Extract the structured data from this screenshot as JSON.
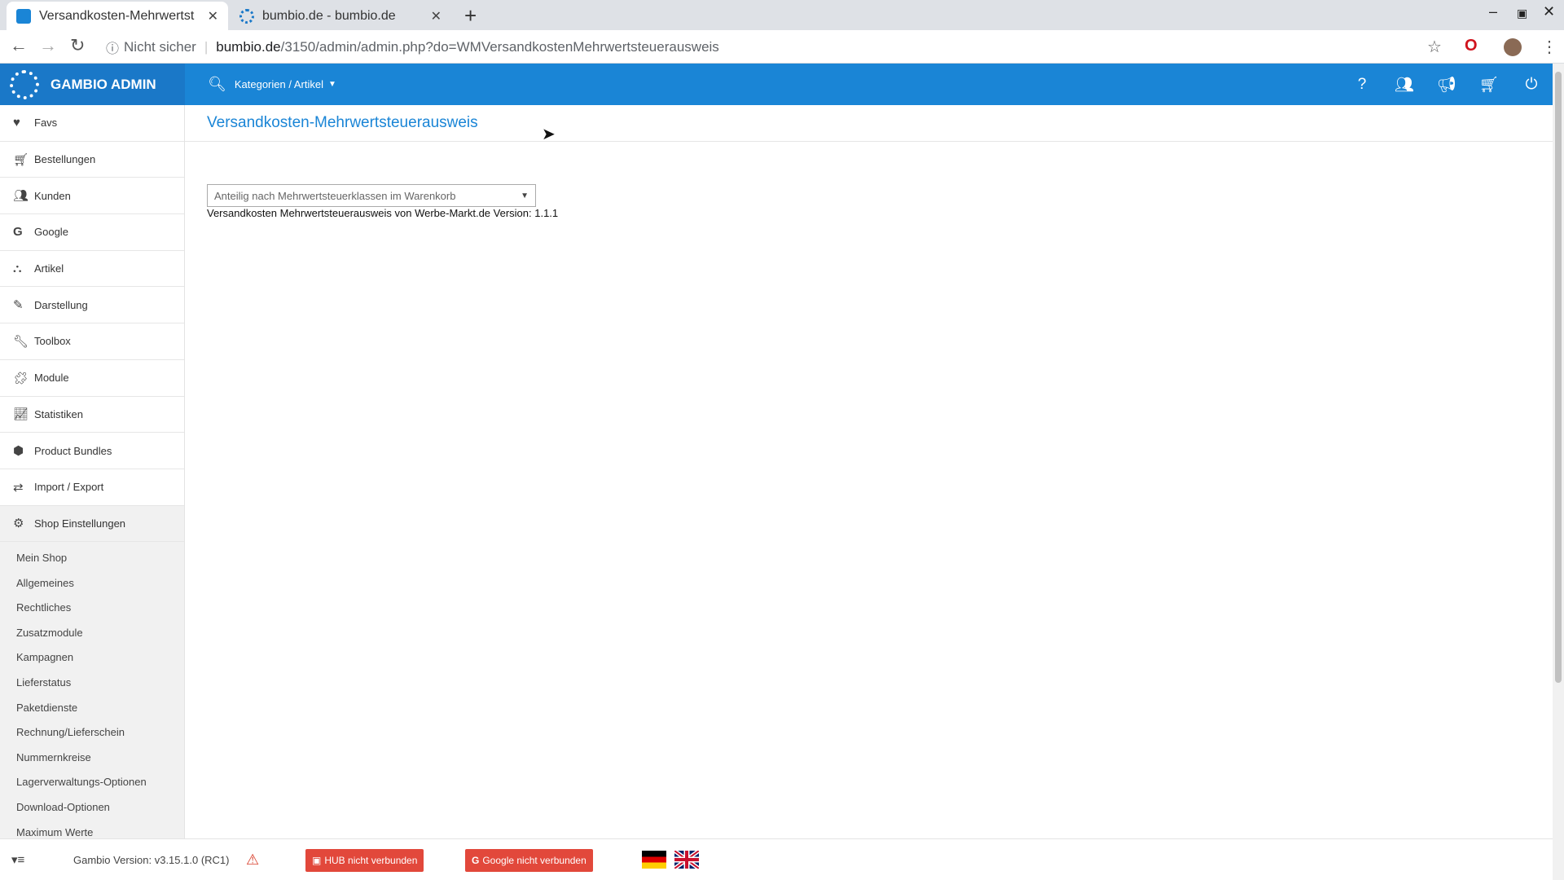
{
  "browser": {
    "tabs": [
      {
        "title": "Versandkosten-Mehrwertst",
        "active": true
      },
      {
        "title": "bumbio.de - bumbio.de",
        "active": false
      }
    ],
    "new_tab": "+",
    "address": {
      "security": "Nicht sicher",
      "host": "bumbio.de",
      "path": "/3150/admin/admin.php?do=WMVersandkostenMehrwertsteuerausweis"
    }
  },
  "header": {
    "brand": "GAMBIO ADMIN",
    "search_label": "Kategorien / Artikel",
    "icons": [
      "help-icon",
      "users-icon",
      "megaphone-icon",
      "cart-icon",
      "power-icon"
    ]
  },
  "sidebar": {
    "items": [
      {
        "label": "Favs",
        "icon": "heart-icon"
      },
      {
        "label": "Bestellungen",
        "icon": "cart-icon"
      },
      {
        "label": "Kunden",
        "icon": "users-icon"
      },
      {
        "label": "Google",
        "icon": "google-icon"
      },
      {
        "label": "Artikel",
        "icon": "sitemap-icon"
      },
      {
        "label": "Darstellung",
        "icon": "brush-icon"
      },
      {
        "label": "Toolbox",
        "icon": "wrench-icon"
      },
      {
        "label": "Module",
        "icon": "puzzle-icon"
      },
      {
        "label": "Statistiken",
        "icon": "chart-icon"
      },
      {
        "label": "Product Bundles",
        "icon": "cubes-icon"
      },
      {
        "label": "Import / Export",
        "icon": "exchange-icon"
      },
      {
        "label": "Shop Einstellungen",
        "icon": "cogs-icon"
      }
    ],
    "subitems": [
      "Mein Shop",
      "Allgemeines",
      "Rechtliches",
      "Zusatzmodule",
      "Kampagnen",
      "Lieferstatus",
      "Paketdienste",
      "Rechnung/Lieferschein",
      "Nummernkreise",
      "Lagerverwaltungs-Optionen",
      "Download-Optionen",
      "Maximum Werte"
    ]
  },
  "main": {
    "title": "Versandkosten-Mehrwertsteuerausweis",
    "select_value": "Anteilig nach Mehrwertsteuerklassen im Warenkorb",
    "version_note": "Versandkosten Mehrwertsteuerausweis von Werbe-Markt.de Version: 1.1.1"
  },
  "footer": {
    "version": "Gambio Version: v3.15.1.0 (RC1)",
    "hub_badge": "HUB nicht verbunden",
    "google_badge": "Google nicht verbunden"
  },
  "colors": {
    "header_blue": "#1a85d6",
    "title_blue": "#1a85d6",
    "badge_red": "#e2483b"
  }
}
